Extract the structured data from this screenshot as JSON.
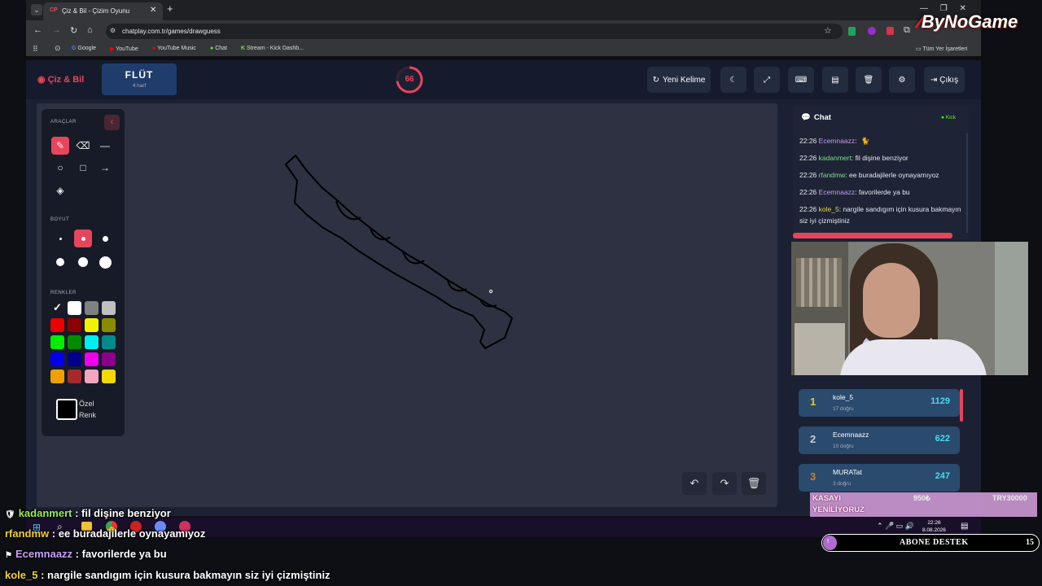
{
  "browser": {
    "tab_title": "Çiz & Bil - Çizim Oyunu",
    "url": "chatplay.com.tr/games/drawguess",
    "bookmarks": [
      "Google",
      "YouTube",
      "YouTube Music",
      "Chat",
      "Stream - Kick Dashb...",
      "Tüm Yer İşaretleri"
    ]
  },
  "watermark": "ByNoGame",
  "app": {
    "logo": "Çiz & Bil",
    "word": "FLÜT",
    "word_hint": "4 harf",
    "timer": "66",
    "timer_fraction": 0.73,
    "new_word": "Yeni Kelime",
    "exit": "Çıkış"
  },
  "tools": {
    "header": "ARAÇLAR",
    "size_label": "BOYUT",
    "colors_label": "RENKLER",
    "custom_color_line1": "Özel",
    "custom_color_line2": "Renk",
    "palette": [
      "#111111",
      "#ffffff",
      "#808080",
      "#c0c0c0",
      "#ee0000",
      "#8b0000",
      "#f2f200",
      "#8b8b00",
      "#00ee00",
      "#008b00",
      "#00eeee",
      "#008b8b",
      "#0000ee",
      "#00008b",
      "#ee00ee",
      "#8b008b",
      "#f0a000",
      "#a52a2a",
      "#f4a6c0",
      "#f5d800"
    ]
  },
  "chat": {
    "title": "Chat",
    "platform": "Kick",
    "messages": [
      {
        "time": "22:26",
        "user": "Ecemnaazz",
        "text": "",
        "color": "#c49af5"
      },
      {
        "time": "22:26",
        "user": "kadanmert",
        "text": "fil dişine benziyor",
        "color": "#7be07b"
      },
      {
        "time": "22:26",
        "user": "rfandmw",
        "text": "ee buradajilerle oynayamıyoz",
        "color": "#7be07b"
      },
      {
        "time": "22:26",
        "user": "Ecemnaazz",
        "text": "favorilerde ya bu",
        "color": "#c49af5"
      },
      {
        "time": "22:26",
        "user": "kole_5",
        "text": "nargile sandıgım için kusura bakmayın siz iyi çizmiştiniz",
        "color": "#e8d84a"
      }
    ]
  },
  "leaderboard": [
    {
      "rank": "1",
      "name": "kole_5",
      "correct": "17 doğru",
      "score": "1129",
      "rank_color": "#f2c230"
    },
    {
      "rank": "2",
      "name": "Ecemnaazz",
      "correct": "10 doğru",
      "score": "622",
      "rank_color": "#c8ccd4"
    },
    {
      "rank": "3",
      "name": "MURATat",
      "correct": "3 doğru",
      "score": "247",
      "rank_color": "#d08030"
    }
  ],
  "banner": {
    "line1": "KASAYI",
    "line2": "YENİLİYORUZ",
    "amount": "950₺",
    "goal": "TRY30000"
  },
  "taskbar": {
    "time": "22:26",
    "date": "8.08.2026"
  },
  "abone": {
    "label": "ABONE DESTEK",
    "count": "15"
  },
  "stream_chat": [
    {
      "user": "kadanmert",
      "text": "fil dişine benziyor",
      "color": "#9be85a"
    },
    {
      "user": "rfandmw",
      "text": "ee buradajilerle oynayamıyoz",
      "color": "#f2d030"
    },
    {
      "user": "Ecemnaazz",
      "text": "favorilerde ya bu",
      "color": "#c8a0f5"
    },
    {
      "user": "kole_5",
      "text": "nargile sandıgım için kusura bakmayın siz iyi çizmiştiniz",
      "color": "#f2d030"
    }
  ]
}
